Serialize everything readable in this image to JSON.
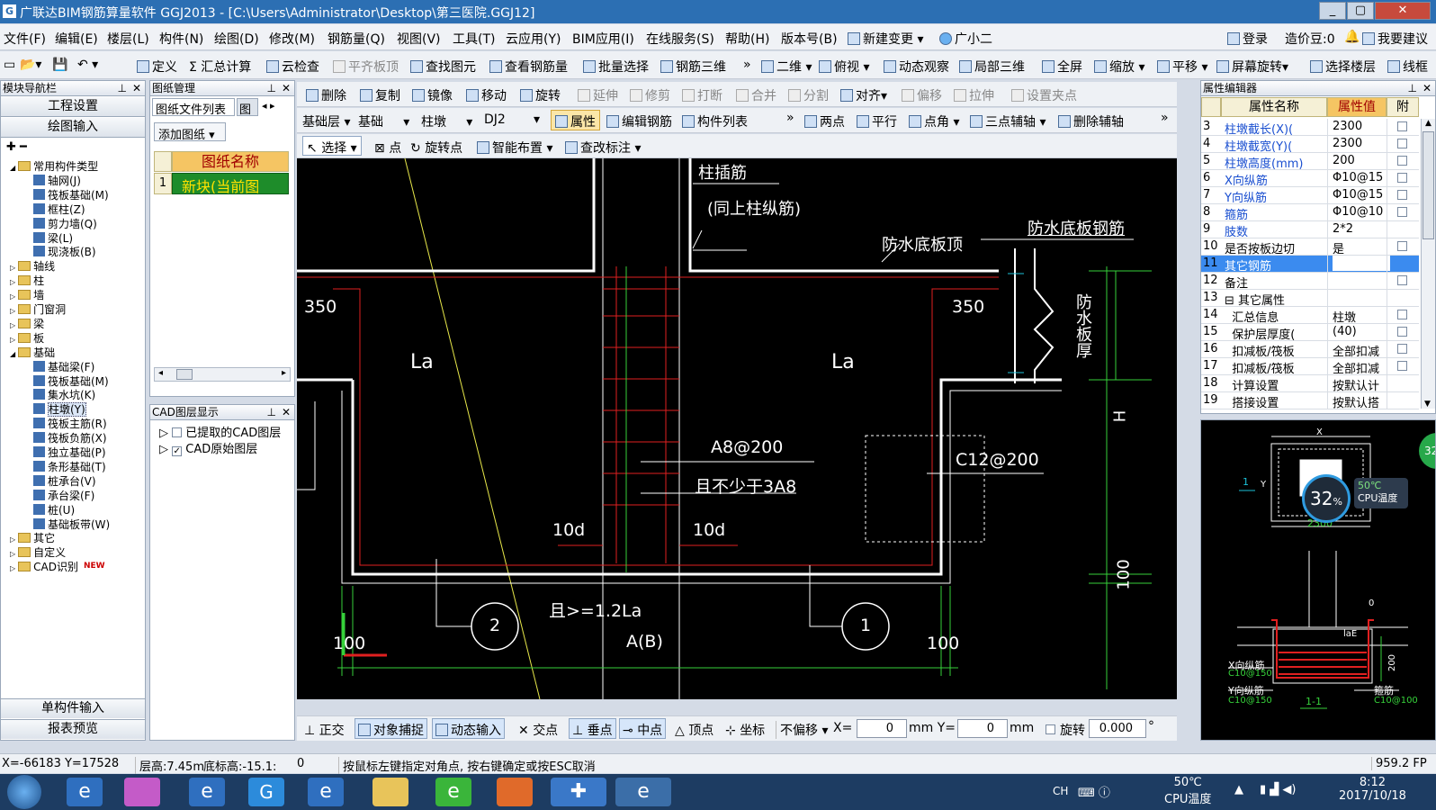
{
  "window": {
    "title": "广联达BIM钢筋算量软件 GGJ2013 - [C:\\Users\\Administrator\\Desktop\\第三医院.GGJ12]",
    "logo": "G",
    "min": "_",
    "max": "▢",
    "close": "✕"
  },
  "menu": [
    "文件(F)",
    "编辑(E)",
    "楼层(L)",
    "构件(N)",
    "绘图(D)",
    "修改(M)",
    "钢筋量(Q)",
    "视图(V)",
    "工具(T)",
    "云应用(Y)",
    "BIM应用(I)",
    "在线服务(S)",
    "帮助(H)",
    "版本号(B)",
    "新建变更",
    "广小二"
  ],
  "menu_right": {
    "login": "登录",
    "coins": "造价豆:0",
    "suggest": "我要建议"
  },
  "toolbar1": [
    "定义",
    "汇总计算",
    "云检查",
    "平齐板顶",
    "查找图元",
    "查看钢筋量",
    "批量选择",
    "钢筋三维",
    "二维",
    "俯视",
    "动态观察",
    "局部三维",
    "全屏",
    "缩放",
    "平移",
    "屏幕旋转",
    "选择楼层",
    "线框"
  ],
  "nav": {
    "title": "模块导航栏",
    "btn_project": "工程设置",
    "btn_draw": "绘图输入",
    "btn_single": "单构件输入",
    "btn_report": "报表预览",
    "tree": [
      {
        "label": "常用构件类型",
        "level": 0,
        "folder": true,
        "exp": "◢"
      },
      {
        "label": "轴网(J)",
        "level": 1
      },
      {
        "label": "筏板基础(M)",
        "level": 1
      },
      {
        "label": "框柱(Z)",
        "level": 1
      },
      {
        "label": "剪力墙(Q)",
        "level": 1
      },
      {
        "label": "梁(L)",
        "level": 1
      },
      {
        "label": "现浇板(B)",
        "level": 1
      },
      {
        "label": "轴线",
        "level": 0,
        "folder": true,
        "exp": "▷"
      },
      {
        "label": "柱",
        "level": 0,
        "folder": true,
        "exp": "▷"
      },
      {
        "label": "墙",
        "level": 0,
        "folder": true,
        "exp": "▷"
      },
      {
        "label": "门窗洞",
        "level": 0,
        "folder": true,
        "exp": "▷"
      },
      {
        "label": "梁",
        "level": 0,
        "folder": true,
        "exp": "▷"
      },
      {
        "label": "板",
        "level": 0,
        "folder": true,
        "exp": "▷"
      },
      {
        "label": "基础",
        "level": 0,
        "folder": true,
        "exp": "◢"
      },
      {
        "label": "基础梁(F)",
        "level": 1
      },
      {
        "label": "筏板基础(M)",
        "level": 1
      },
      {
        "label": "集水坑(K)",
        "level": 1
      },
      {
        "label": "柱墩(Y)",
        "level": 1
      },
      {
        "label": "筏板主筋(R)",
        "level": 1
      },
      {
        "label": "筏板负筋(X)",
        "level": 1
      },
      {
        "label": "独立基础(P)",
        "level": 1
      },
      {
        "label": "条形基础(T)",
        "level": 1
      },
      {
        "label": "桩承台(V)",
        "level": 1
      },
      {
        "label": "承台梁(F)",
        "level": 1
      },
      {
        "label": "桩(U)",
        "level": 1
      },
      {
        "label": "基础板带(W)",
        "level": 1
      },
      {
        "label": "其它",
        "level": 0,
        "folder": true,
        "exp": "▷"
      },
      {
        "label": "自定义",
        "level": 0,
        "folder": true,
        "exp": "▷"
      },
      {
        "label": "CAD识别",
        "level": 0,
        "folder": true,
        "exp": "▷"
      }
    ],
    "new_badge": "NEW"
  },
  "drawing": {
    "title": "图纸管理",
    "tab1": "图纸文件列表",
    "tab2": "图纸",
    "add": "添加图纸",
    "col": "图纸名称",
    "row_no": "1",
    "row_name": "新块(当前图"
  },
  "cad_layers": {
    "title": "CAD图层显示",
    "items": [
      "已提取的CAD图层",
      "CAD原始图层"
    ]
  },
  "edit_toolbar": [
    "删除",
    "复制",
    "镜像",
    "移动",
    "旋转",
    "延伸",
    "修剪",
    "打断",
    "合并",
    "分割",
    "对齐",
    "偏移",
    "拉伸",
    "设置夹点"
  ],
  "selectors": {
    "floor": "基础层",
    "cat": "基础",
    "type": "柱墩",
    "name": "DJ2",
    "prop": "属性",
    "edit": "编辑钢筋",
    "list": "构件列表",
    "axis": [
      "两点",
      "平行",
      "点角",
      "三点辅轴",
      "删除辅轴"
    ]
  },
  "draw_toolbar": [
    "选择",
    "点",
    "旋转点",
    "智能布置",
    "查改标注"
  ],
  "canvas_text": {
    "a": "柱插筋",
    "b": "(同上柱纵筋)",
    "c": "防水底板顶",
    "d": "防水底板钢筋",
    "e": "防水板厚",
    "f": "350",
    "g": "350",
    "h": "La",
    "i": "La",
    "j": "A8@200",
    "k": "且不少于3A8",
    "l": "C12@200",
    "m": "10d",
    "n": "10d",
    "o": "H",
    "p": "100",
    "q": "且>=1.2La",
    "r": "A(B)",
    "s": "2",
    "t": "1",
    "u": "100",
    "v": "100"
  },
  "snap_bar": {
    "items": [
      "正交",
      "对象捕捉",
      "动态输入",
      "交点",
      "垂点",
      "中点",
      "顶点",
      "坐标"
    ],
    "offset": "不偏移",
    "x_label": "X=",
    "x_val": "0",
    "y_label": "mm Y=",
    "y_val": "0",
    "mm": "mm",
    "rot": "旋转",
    "rot_val": "0.000",
    "deg": "°"
  },
  "props": {
    "title": "属性编辑器",
    "h1": "属性名称",
    "h2": "属性值",
    "h3": "附",
    "rows": [
      {
        "n": "3",
        "name": "柱墩截长(X)(",
        "val": "2300",
        "blue": true,
        "chk": true
      },
      {
        "n": "4",
        "name": "柱墩截宽(Y)(",
        "val": "2300",
        "blue": true,
        "chk": true
      },
      {
        "n": "5",
        "name": "柱墩高度(mm)",
        "val": "200",
        "blue": true,
        "chk": true
      },
      {
        "n": "6",
        "name": "X向纵筋",
        "val": "Φ10@15",
        "blue": true,
        "chk": true
      },
      {
        "n": "7",
        "name": "Y向纵筋",
        "val": "Φ10@15",
        "blue": true,
        "chk": true
      },
      {
        "n": "8",
        "name": "箍筋",
        "val": "Φ10@10",
        "blue": true,
        "chk": true
      },
      {
        "n": "9",
        "name": "肢数",
        "val": "2*2",
        "blue": true,
        "chk": false
      },
      {
        "n": "10",
        "name": "是否按板边切",
        "val": "是",
        "blue": false,
        "chk": true
      },
      {
        "n": "11",
        "name": "其它钢筋",
        "val": "",
        "blue": false,
        "chk": false,
        "sel": true
      },
      {
        "n": "12",
        "name": "备注",
        "val": "",
        "blue": false,
        "chk": true
      },
      {
        "n": "13",
        "name": "⊟ 其它属性",
        "val": "",
        "blue": false,
        "chk": false
      },
      {
        "n": "14",
        "name": "  汇总信息",
        "val": "柱墩",
        "blue": false,
        "chk": true
      },
      {
        "n": "15",
        "name": "  保护层厚度(",
        "val": "(40)",
        "blue": false,
        "chk": true
      },
      {
        "n": "16",
        "name": "  扣减板/筏板",
        "val": "全部扣减",
        "blue": false,
        "chk": true
      },
      {
        "n": "17",
        "name": "  扣减板/筏板",
        "val": "全部扣减",
        "blue": false,
        "chk": true
      },
      {
        "n": "18",
        "name": "  计算设置",
        "val": "按默认计",
        "blue": false,
        "chk": false
      },
      {
        "n": "19",
        "name": "  搭接设置",
        "val": "按默认搭",
        "blue": false,
        "chk": false
      }
    ]
  },
  "preview": {
    "dim1": "X",
    "dim2": "2300",
    "dim3": "1",
    "dim4": "Y",
    "temp": "32",
    "temp_unit": "%",
    "cpu_temp": "50℃",
    "cpu_label": "CPU温度",
    "x_rebar": "X向纵筋",
    "x_val": "C10@150",
    "y_rebar": "Y向纵筋",
    "y_val": "C10@150",
    "stirrup": "箍筋",
    "stirrup_val": "C10@100",
    "section": "1-1",
    "lae": "laE",
    "d0": "0",
    "d200": "200",
    "badge": "32"
  },
  "status": {
    "coords": "X=-66183 Y=17528",
    "floor_h": "层高:7.45m",
    "base_h": "底标高:-15.1:",
    "zero": "0",
    "hint": "按鼠标左键指定对角点, 按右键确定或按ESC取消",
    "fps": "959.2 FP"
  },
  "taskbar": {
    "lang": "CH",
    "temp": "50℃",
    "cpu": "CPU温度",
    "time": "8:12",
    "date": "2017/10/18"
  }
}
